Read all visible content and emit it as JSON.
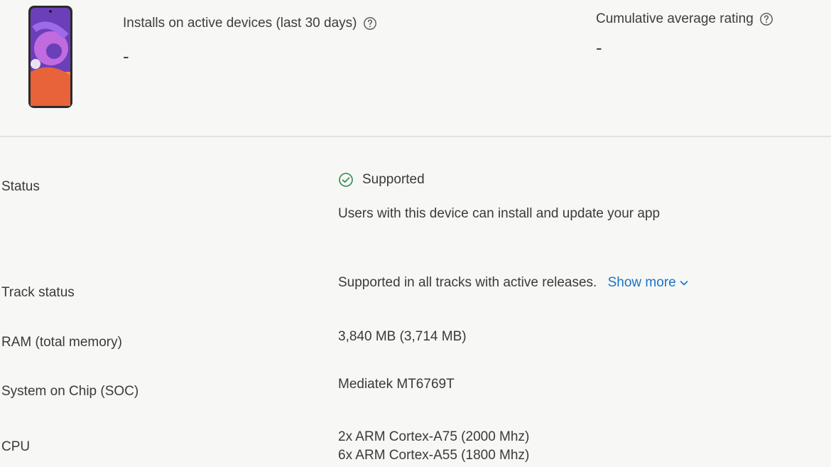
{
  "header": {
    "installs_label": "Installs on active devices (last 30 days)",
    "installs_value": "-",
    "rating_label": "Cumulative average rating",
    "rating_value": "-"
  },
  "details": {
    "status": {
      "label": "Status",
      "value": "Supported",
      "description": "Users with this device can install and update your app"
    },
    "track_status": {
      "label": "Track status",
      "value": "Supported in all tracks with active releases.",
      "show_more": "Show more"
    },
    "ram": {
      "label": "RAM (total memory)",
      "value": "3,840 MB (3,714 MB)"
    },
    "soc": {
      "label": "System on Chip (SOC)",
      "value": "Mediatek MT6769T"
    },
    "cpu": {
      "label": "CPU",
      "values": [
        "2x ARM Cortex-A75 (2000 Mhz)",
        "6x ARM Cortex-A55 (1800 Mhz)"
      ]
    }
  },
  "colors": {
    "accent": "#1a73c8",
    "supported_green": "#2e8b4f",
    "background": "#f7f7f5"
  },
  "icons": {
    "device": "phone-device-icon",
    "help": "help-circle-icon",
    "status": "check-circle-icon",
    "expand": "chevron-down-icon"
  }
}
